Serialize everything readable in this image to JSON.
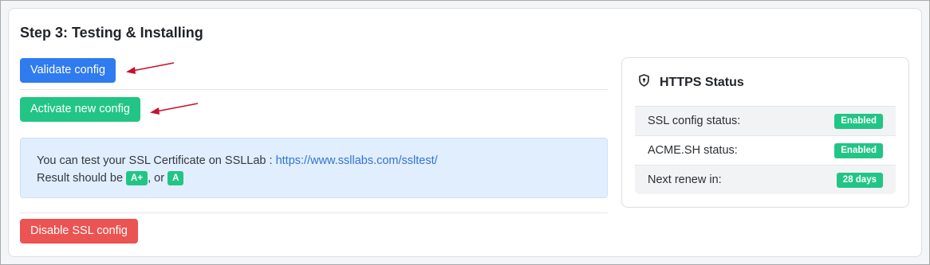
{
  "page": {
    "title": "Step 3: Testing & Installing"
  },
  "buttons": {
    "validate": "Validate config",
    "activate": "Activate new config",
    "disable": "Disable SSL config"
  },
  "info": {
    "line1_text": "You can test your SSL Certificate on SSLLab : ",
    "link_text": "https://www.ssllabs.com/ssltest/",
    "line2_text": "Result should be ",
    "grade1": "A+",
    "separator": ", or ",
    "grade2": "A"
  },
  "status": {
    "title": "HTTPS Status",
    "icon": "shield-icon",
    "rows": [
      {
        "label": "SSL config status:",
        "value": "Enabled"
      },
      {
        "label": "ACME.SH status:",
        "value": "Enabled"
      },
      {
        "label": "Next renew in:",
        "value": "28 days"
      }
    ]
  },
  "colors": {
    "primary": "#2f7bf0",
    "success": "#22c585",
    "danger": "#ec5353",
    "annotation_arrow": "#c8102e"
  }
}
